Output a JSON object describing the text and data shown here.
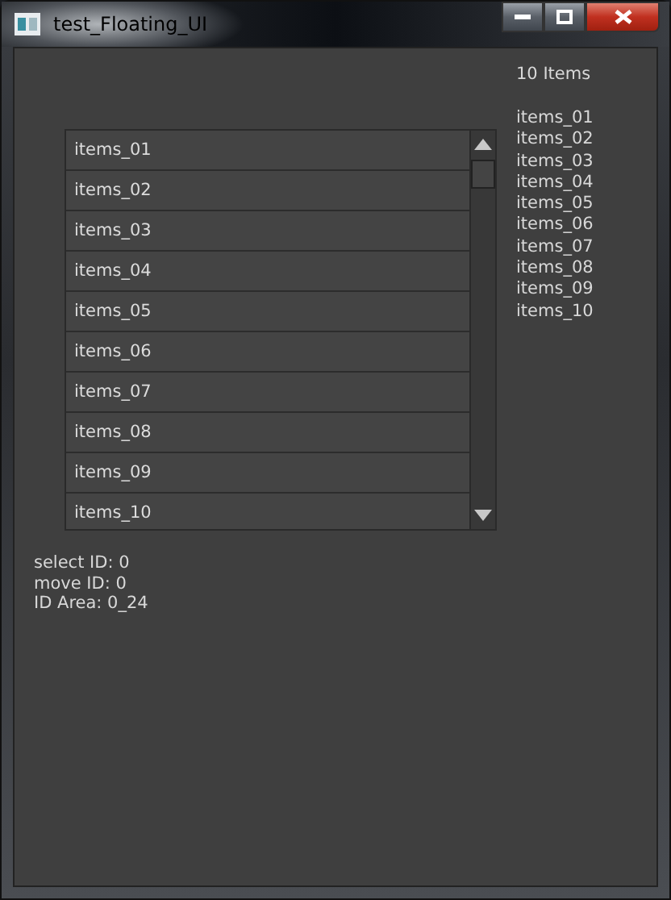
{
  "window": {
    "title": "test_Floating_UI"
  },
  "list": {
    "items": [
      "items_01",
      "items_02",
      "items_03",
      "items_04",
      "items_05",
      "items_06",
      "items_07",
      "items_08",
      "items_09",
      "items_10"
    ]
  },
  "summary": {
    "count": "10 Items",
    "items": [
      "items_01",
      "items_02",
      "items_03",
      "items_04",
      "items_05",
      "items_06",
      "items_07",
      "items_08",
      "items_09",
      "items_10"
    ]
  },
  "status": [
    "select ID: 0",
    "move ID: 0",
    "ID Area: 0_24"
  ]
}
